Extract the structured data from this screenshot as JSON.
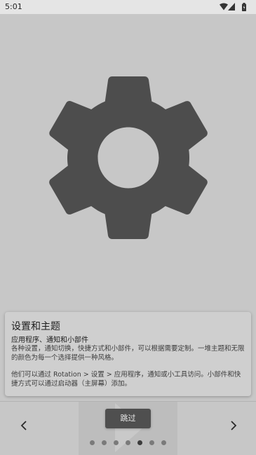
{
  "status_bar": {
    "time": "5:01",
    "icons": [
      "wifi-icon",
      "signal-icon",
      "battery-icon"
    ]
  },
  "hero": {
    "icon": "settings-gear-icon",
    "icon_color": "#4d4d4d"
  },
  "card": {
    "title": "设置和主题",
    "subtitle": "应用程序、通知和小部件",
    "paragraph_1": "各种设置，通知切换，快捷方式和小部件，可以根据需要定制。一堆主题和无限的颜色为每一个选择提供一种风格。",
    "paragraph_2": "他们可以通过 Rotation > 设置 > 应用程序，通知或小工具访问。小部件和快捷方式可以通过启动器（主屏幕）添加。"
  },
  "navigation": {
    "prev_icon": "chevron-left-icon",
    "next_icon": "chevron-right-icon",
    "skip_label": "跳过",
    "pages_total": 7,
    "current_page": 5
  },
  "colors": {
    "background": "#c7c7c7",
    "card": "#cfcfcf",
    "button": "#4f4f4f"
  }
}
